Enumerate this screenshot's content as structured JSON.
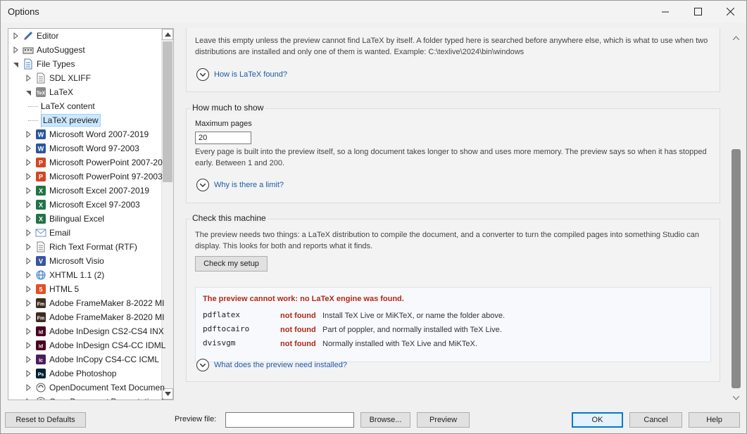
{
  "window": {
    "title": "Options"
  },
  "tree": {
    "items": [
      {
        "label": "Editor",
        "icon": "pencil-icon"
      },
      {
        "label": "AutoSuggest",
        "icon": "keyboard-icon"
      },
      {
        "label": "File Types",
        "icon": "gear-doc-icon"
      },
      {
        "label": "SDL XLIFF",
        "icon": "document-icon"
      },
      {
        "label": "LaTeX",
        "icon": "tex-icon"
      },
      {
        "label": "LaTeX content",
        "icon": ""
      },
      {
        "label": "LaTeX preview",
        "icon": ""
      },
      {
        "label": "Microsoft Word 2007-2019",
        "icon": "word-icon"
      },
      {
        "label": "Microsoft Word 97-2003",
        "icon": "word-icon"
      },
      {
        "label": "Microsoft PowerPoint 2007-20",
        "icon": "powerpoint-icon"
      },
      {
        "label": "Microsoft PowerPoint 97-2003",
        "icon": "powerpoint-icon"
      },
      {
        "label": "Microsoft Excel 2007-2019",
        "icon": "excel-icon"
      },
      {
        "label": "Microsoft Excel 97-2003",
        "icon": "excel-icon"
      },
      {
        "label": "Bilingual Excel",
        "icon": "excel-icon"
      },
      {
        "label": "Email",
        "icon": "email-icon"
      },
      {
        "label": "Rich Text Format (RTF)",
        "icon": "document-icon"
      },
      {
        "label": "Microsoft Visio",
        "icon": "visio-icon"
      },
      {
        "label": "XHTML 1.1 (2)",
        "icon": "globe-icon"
      },
      {
        "label": "HTML 5",
        "icon": "html5-icon"
      },
      {
        "label": "Adobe FrameMaker 8-2022 MI",
        "icon": "framemaker-icon"
      },
      {
        "label": "Adobe FrameMaker 8-2020 MI",
        "icon": "framemaker-icon"
      },
      {
        "label": "Adobe InDesign CS2-CS4 INX",
        "icon": "indesign-icon"
      },
      {
        "label": "Adobe InDesign CS4-CC IDML",
        "icon": "indesign-icon"
      },
      {
        "label": "Adobe InCopy CS4-CC ICML",
        "icon": "incopy-icon"
      },
      {
        "label": "Adobe Photoshop",
        "icon": "photoshop-icon"
      },
      {
        "label": "OpenDocument Text Documen",
        "icon": "opendocument-icon"
      },
      {
        "label": "OpenDocument Presentation (",
        "icon": "opendocument-icon"
      }
    ]
  },
  "intro": {
    "line1": "Leave this empty unless the preview cannot find LaTeX by itself. A folder typed here is searched before anywhere else, which is what to use when two",
    "line2": "distributions are installed and only one of them is wanted. Example: C:\\texlive\\2024\\bin\\windows",
    "link": "How is LaTeX found?"
  },
  "how_much": {
    "title": "How much to show",
    "field_label": "Maximum pages",
    "field_value": "20",
    "desc_line1": "Every page is built into the preview itself, so a long document takes longer to show and uses more memory. The preview says so when it has stopped",
    "desc_line2": "early. Between 1 and 200.",
    "link": "Why is there a limit?"
  },
  "check": {
    "title": "Check this machine",
    "desc_line1": "The preview needs two things: a LaTeX distribution to compile the document, and a converter to turn the compiled pages into something Studio can",
    "desc_line2": "display. This looks for both and reports what it finds.",
    "button": "Check my setup",
    "error": "The preview cannot work: no LaTeX engine was found.",
    "results": [
      {
        "tool": "pdflatex",
        "status": "not found",
        "hint": "Install TeX Live or MiKTeX, or name the folder above."
      },
      {
        "tool": "pdftocairo",
        "status": "not found",
        "hint": "Part of poppler, and normally installed with TeX Live."
      },
      {
        "tool": "dvisvgm",
        "status": "not found",
        "hint": "Normally installed with TeX Live and MiKTeX."
      }
    ],
    "link": "What does the preview need installed?"
  },
  "footer": {
    "reset": "Reset to Defaults",
    "preview_file_label": "Preview file:",
    "preview_file_value": "",
    "browse": "Browse...",
    "preview": "Preview",
    "ok": "OK",
    "cancel": "Cancel",
    "help": "Help"
  },
  "colors": {
    "accent": "#0078d4",
    "error": "#b02a18",
    "link": "#1b5aa8"
  }
}
